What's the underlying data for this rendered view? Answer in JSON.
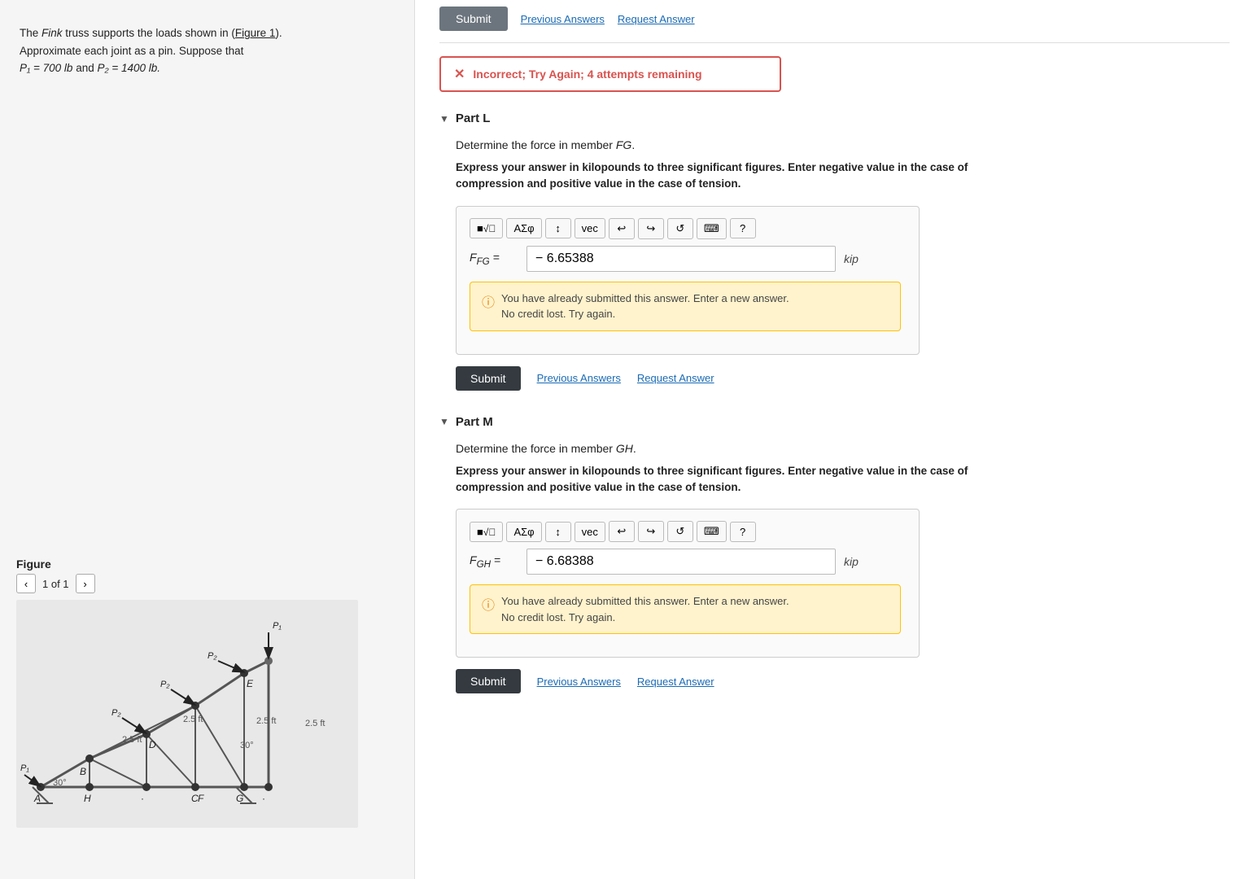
{
  "left": {
    "problem_text_1": "The ",
    "problem_fink": "Fink",
    "problem_text_2": " truss supports the loads shown in (",
    "problem_figure": "Figure 1",
    "problem_text_3": ").",
    "problem_line2": "Approximate each joint as a pin. Suppose that",
    "problem_p1": "P₁ = 700 lb",
    "problem_and": " and ",
    "problem_p2": "P₂ = 1400 lb.",
    "figure_label": "Figure",
    "nav_page": "1 of 1"
  },
  "top_bar": {
    "submit_label": "Submit",
    "link1": "Previous Answers",
    "link2": "Request Answer"
  },
  "error_banner": {
    "icon": "✕",
    "text": "Incorrect; Try Again; 4 attempts remaining"
  },
  "part_l": {
    "title": "Part L",
    "question_pre": "Determine the force in member ",
    "question_member": "FG",
    "question_post": ".",
    "instruction": "Express your answer in kilopounds to three significant figures. Enter negative value in the case of\ncompression and positive value in the case of tension.",
    "toolbar_buttons": [
      {
        "label": "■√⃞",
        "name": "math-template"
      },
      {
        "label": "ΑΣφ",
        "name": "greek-symbols"
      },
      {
        "label": "↕",
        "name": "arrows"
      },
      {
        "label": "vec",
        "name": "vector"
      },
      {
        "label": "↩",
        "name": "undo"
      },
      {
        "label": "↪",
        "name": "redo"
      },
      {
        "label": "↺",
        "name": "reset"
      },
      {
        "label": "⌨",
        "name": "keyboard"
      },
      {
        "label": "?",
        "name": "help"
      }
    ],
    "input_label": "F_FG =",
    "input_value": "− 6.65388",
    "unit": "kip",
    "warning_text_1": "You have already submitted this answer. Enter a new answer.",
    "warning_text_2": "No credit lost. Try again.",
    "submit_label": "Submit",
    "prev_answers": "Previous Answers",
    "request_answer": "Request Answer"
  },
  "part_m": {
    "title": "Part M",
    "question_pre": "Determine the force in member ",
    "question_member": "GH",
    "question_post": ".",
    "instruction": "Express your answer in kilopounds to three significant figures. Enter negative value in the case of\ncompression and positive value in the case of tension.",
    "toolbar_buttons": [
      {
        "label": "■√⃞",
        "name": "math-template"
      },
      {
        "label": "ΑΣφ",
        "name": "greek-symbols"
      },
      {
        "label": "↕",
        "name": "arrows"
      },
      {
        "label": "vec",
        "name": "vector"
      },
      {
        "label": "↩",
        "name": "undo"
      },
      {
        "label": "↪",
        "name": "redo"
      },
      {
        "label": "↺",
        "name": "reset"
      },
      {
        "label": "⌨",
        "name": "keyboard"
      },
      {
        "label": "?",
        "name": "help"
      }
    ],
    "input_label": "F_GH =",
    "input_value": "− 6.68388",
    "unit": "kip",
    "warning_text_1": "You have already submitted this answer. Enter a new answer.",
    "warning_text_2": "No credit lost. Try again.",
    "submit_label": "Submit",
    "prev_answers": "Previous Answers",
    "request_answer": "Request Answer"
  }
}
